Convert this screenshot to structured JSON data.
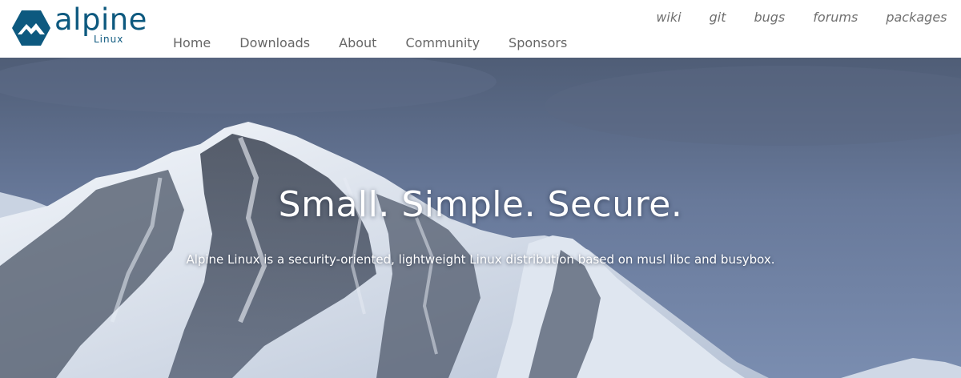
{
  "brand": {
    "name": "alpine",
    "subname": "Linux",
    "color": "#0d597f"
  },
  "main_nav": [
    {
      "label": "Home"
    },
    {
      "label": "Downloads"
    },
    {
      "label": "About"
    },
    {
      "label": "Community"
    },
    {
      "label": "Sponsors"
    }
  ],
  "util_nav": [
    {
      "label": "wiki"
    },
    {
      "label": "git"
    },
    {
      "label": "bugs"
    },
    {
      "label": "forums"
    },
    {
      "label": "packages"
    }
  ],
  "hero": {
    "title": "Small. Simple. Secure.",
    "subtitle": "Alpine Linux is a security-oriented, lightweight Linux distribution based on musl libc and busybox."
  },
  "colors": {
    "nav_text": "#666666",
    "util_text": "#707070",
    "hero_sky": "#67799a",
    "hero_text": "#ffffff"
  }
}
